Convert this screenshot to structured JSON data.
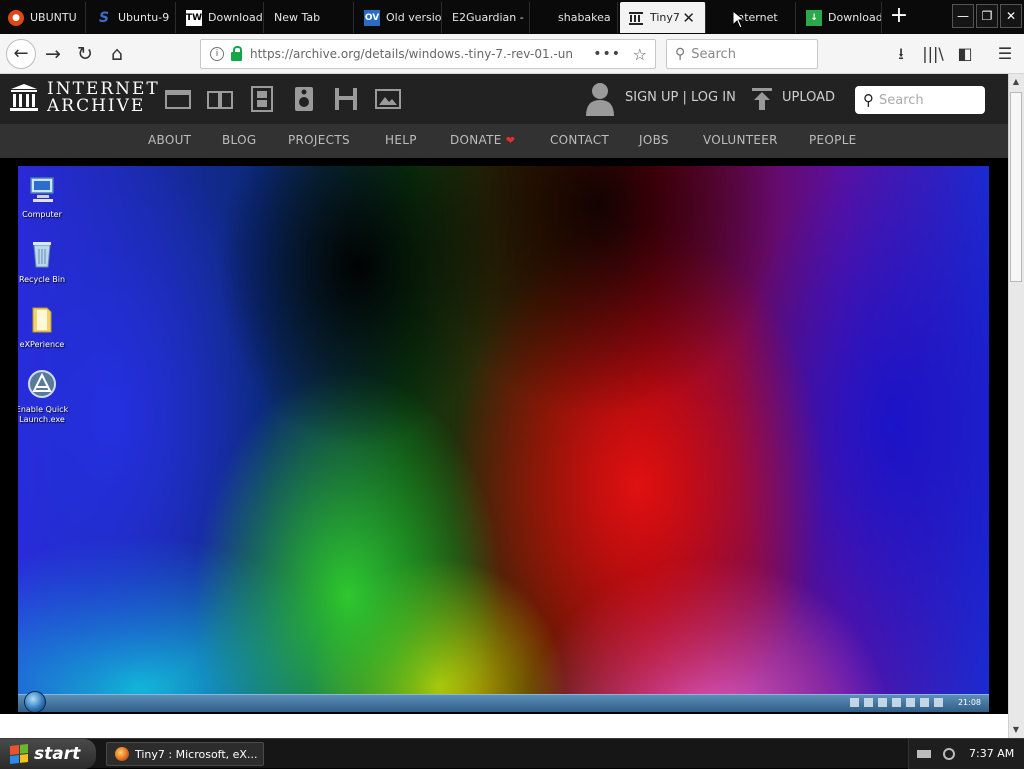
{
  "browser": {
    "tabs": [
      {
        "label": "UBUNTU",
        "icon": "ubuntu-icon"
      },
      {
        "label": "Ubuntu-9",
        "icon": "s-logo-icon"
      },
      {
        "label": "Download",
        "icon": "tw-logo-icon",
        "icon_text": "TW"
      },
      {
        "label": "New Tab",
        "icon": ""
      },
      {
        "label": "Old versio",
        "icon": "ov-logo-icon",
        "icon_text": "OV"
      },
      {
        "label": "E2Guardian -",
        "icon": ""
      },
      {
        "label": "shabakea",
        "icon": ""
      },
      {
        "label": "Tiny7",
        "icon": "archive-icon",
        "active": true
      },
      {
        "label": "Internet",
        "icon": ""
      },
      {
        "label": "Download",
        "icon": "download-green-icon"
      }
    ],
    "url": "https://archive.org/details/windows.-tiny-7.-rev-01.-un",
    "search_placeholder": "Search"
  },
  "ia": {
    "logo_line1": "INTERNET",
    "logo_line2": "ARCHIVE",
    "signup": "SIGN UP | LOG IN",
    "upload": "UPLOAD",
    "search_placeholder": "Search",
    "nav": [
      "ABOUT",
      "BLOG",
      "PROJECTS",
      "HELP",
      "DONATE",
      "CONTACT",
      "JOBS",
      "VOLUNTEER",
      "PEOPLE"
    ]
  },
  "emulator": {
    "desktop_icons": [
      {
        "label": "Computer"
      },
      {
        "label": "Recycle Bin"
      },
      {
        "label": "eXPerience"
      },
      {
        "label": "Enable Quick Launch.exe"
      }
    ],
    "clock": "21:08"
  },
  "taskbar": {
    "start_label": "start",
    "task_label": "Tiny7 : Microsoft, eX...",
    "clock": "7:37 AM"
  },
  "colors": {
    "browser_chrome": "#0a0a0a",
    "ia_header": "#222222",
    "ia_nav": "#323232",
    "donate_heart": "#e03030"
  }
}
